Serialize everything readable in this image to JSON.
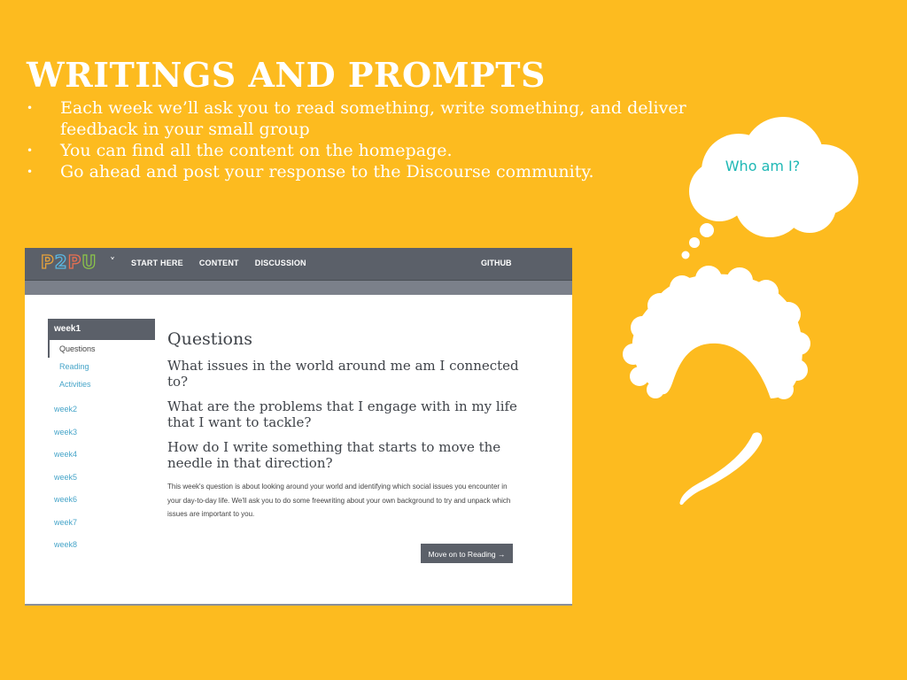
{
  "slide": {
    "title": "WRITINGS AND PROMPTS",
    "bullets": [
      "Each week we’ll ask you to read something, write something, and deliver feedback in your small group",
      "You can find all the content on the homepage.",
      "Go ahead and post your response to the Discourse community."
    ],
    "bullet_glyph": "•",
    "bubble_text": "Who am I?",
    "background_color": "#FDBB1F",
    "bubble_text_color": "#1FB8B5"
  },
  "screenshot": {
    "logo": [
      "P",
      "2",
      "P",
      "U"
    ],
    "logo_colors": [
      "#E6A23C",
      "#5BB6E0",
      "#E76F51",
      "#8BC34A"
    ],
    "menu_caret": "˅",
    "nav": [
      "START HERE",
      "CONTENT",
      "DISCUSSION"
    ],
    "nav_right": "GITHUB",
    "sidebar": {
      "active_week": "week1",
      "subitems": [
        "Questions",
        "Reading",
        "Activities"
      ],
      "weeks": [
        "week2",
        "week3",
        "week4",
        "week5",
        "week6",
        "week7",
        "week8"
      ]
    },
    "main": {
      "heading": "Questions",
      "questions": [
        "What issues in the world around me am I connected to?",
        "What are the problems that I engage with in my life that I want to tackle?",
        "How do I write something that starts to move the needle in that direction?"
      ],
      "body": "This week's question is about looking around your world and identifying which social issues you encounter in your day-to-day life. We'll ask you to do some freewriting about your own background to try and unpack which issues are important to you.",
      "button": "Move on to Reading →"
    }
  }
}
